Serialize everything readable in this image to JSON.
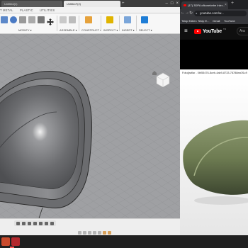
{
  "fusion": {
    "tabs": [
      {
        "label": "Untitled(1)"
      },
      {
        "label": "Untitled*(2)"
      }
    ],
    "new_tab_glyph": "+",
    "section_labels": [
      "T METAL",
      "PLASTIC",
      "UTILITIES"
    ],
    "toolbar_groups": [
      {
        "label": "MODIFY ▾",
        "icon": "modify-icon"
      },
      {
        "label": "ASSEMBLE ▾",
        "icon": "assemble-icon"
      },
      {
        "label": "CONSTRUCT ▾",
        "icon": "construct-icon"
      },
      {
        "label": "INSPECT ▾",
        "icon": "inspect-icon"
      },
      {
        "label": "INSERT ▾",
        "icon": "insert-icon"
      },
      {
        "label": "SELECT ▾",
        "icon": "select-icon"
      }
    ],
    "window_controls": [
      "–",
      "□",
      "×"
    ],
    "viewcube_label": "FRONT",
    "colors": {
      "viewport_bg": "#9fa0a3",
      "body_fill": "#7b7c7f",
      "accent_blue": "#1e7dd6"
    }
  },
  "browser": {
    "tab_title": "(17) 3DPA ofkonebebe Inler...",
    "tab_close": "×",
    "new_tab": "+",
    "nav_buttons": [
      "←",
      "→",
      "↻"
    ],
    "url": "youtube.com/w...",
    "bookmarks": [
      "Tekip Edilen",
      "Tekip E...",
      "Gmail",
      "YouTube"
    ],
    "youtube": {
      "wordmark": "YouTube",
      "region": "TR",
      "search_placeholder": "Ara"
    },
    "video_title": "Fotoğraflar - 0bf55476-8ceb-4ab9-8733-78788ea0f1c9"
  },
  "taskbar": {
    "apps": [
      "fusion-app-icon",
      "youtube-app-icon"
    ]
  }
}
